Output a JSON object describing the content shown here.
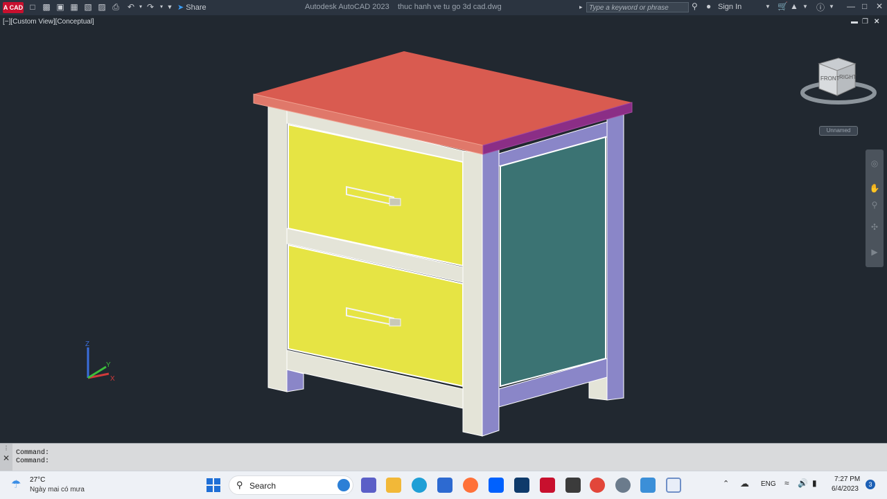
{
  "titlebar": {
    "logo_text": "A CAD",
    "share_label": "Share",
    "app_name": "Autodesk AutoCAD 2023",
    "file_name": "thuc hanh ve tu go 3d cad.dwg",
    "search_placeholder": "Type a keyword or phrase",
    "signin_label": "Sign In"
  },
  "viewport": {
    "label": "[−][Custom View][Conceptual]",
    "viewcube": {
      "front": "FRONT",
      "right": "RIGHT",
      "named_view": "Unnamed"
    },
    "ucs": {
      "x": "X",
      "y": "Y",
      "z": "Z"
    }
  },
  "model": {
    "colors": {
      "top": "#d95b50",
      "top_front_edge": "#e0786a",
      "top_right_edge": "#8b2e86",
      "frame_front": "#e4e4d8",
      "frame_side": "#8a86c8",
      "drawer": "#e6e444",
      "side_panel": "#3b7373",
      "handle": "#ececec"
    }
  },
  "command": {
    "lines": [
      "Command:",
      "Command:"
    ]
  },
  "taskbar": {
    "weather_temp": "27°C",
    "weather_desc": "Ngày mai có mưa",
    "search_label": "Search",
    "language": "ENG",
    "time": "7:27 PM",
    "date": "6/4/2023",
    "notification_count": "3"
  }
}
